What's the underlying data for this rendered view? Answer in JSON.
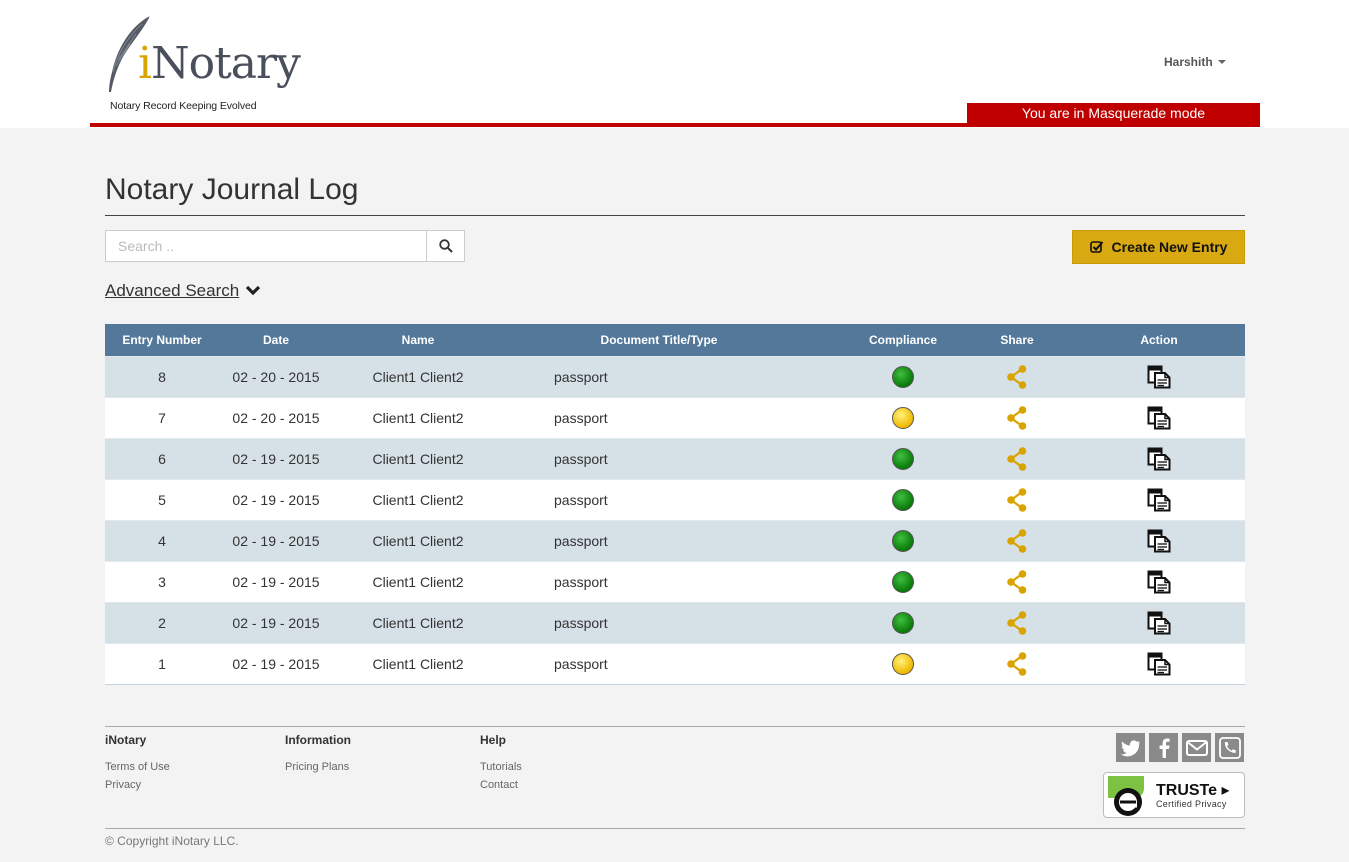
{
  "header": {
    "logo_word_prefix": "i",
    "logo_word_rest": "Notary",
    "logo_tagline": "Notary Record Keeping Evolved",
    "user_name": "Harshith",
    "masquerade_text": "You are in Masquerade mode"
  },
  "main": {
    "title": "Notary Journal Log",
    "search_placeholder": "Search ..",
    "create_button_label": "Create New Entry",
    "advanced_search_label": "Advanced Search"
  },
  "table": {
    "columns": [
      "Entry Number",
      "Date",
      "Name",
      "Document Title/Type",
      "Compliance",
      "Share",
      "Action"
    ],
    "rows": [
      {
        "entry": "8",
        "date": "02 - 20 - 2015",
        "name": "Client1 Client2",
        "doc": "passport",
        "compliance": "green"
      },
      {
        "entry": "7",
        "date": "02 - 20 - 2015",
        "name": "Client1 Client2",
        "doc": "passport",
        "compliance": "yellow"
      },
      {
        "entry": "6",
        "date": "02 - 19 - 2015",
        "name": "Client1 Client2",
        "doc": "passport",
        "compliance": "green"
      },
      {
        "entry": "5",
        "date": "02 - 19 - 2015",
        "name": "Client1 Client2",
        "doc": "passport",
        "compliance": "green"
      },
      {
        "entry": "4",
        "date": "02 - 19 - 2015",
        "name": "Client1 Client2",
        "doc": "passport",
        "compliance": "green"
      },
      {
        "entry": "3",
        "date": "02 - 19 - 2015",
        "name": "Client1 Client2",
        "doc": "passport",
        "compliance": "green"
      },
      {
        "entry": "2",
        "date": "02 - 19 - 2015",
        "name": "Client1 Client2",
        "doc": "passport",
        "compliance": "green"
      },
      {
        "entry": "1",
        "date": "02 - 19 - 2015",
        "name": "Client1 Client2",
        "doc": "passport",
        "compliance": "yellow"
      }
    ]
  },
  "footer": {
    "col1": {
      "heading": "iNotary",
      "links": [
        "Terms of Use",
        "Privacy"
      ]
    },
    "col2": {
      "heading": "Information",
      "links": [
        "Pricing Plans"
      ]
    },
    "col3": {
      "heading": "Help",
      "links": [
        "Tutorials",
        "Contact"
      ]
    },
    "social_icons": [
      "twitter-icon",
      "facebook-icon",
      "email-icon",
      "phone-icon"
    ],
    "truste_name": "TRUSTe",
    "truste_sub": "Certified Privacy",
    "copyright": "© Copyright iNotary LLC."
  },
  "colors": {
    "brand_red": "#c00000",
    "accent_gold": "#d8a910",
    "table_header": "#53789a",
    "row_alt": "#d6e0e7",
    "share_icon": "#d9a400"
  }
}
